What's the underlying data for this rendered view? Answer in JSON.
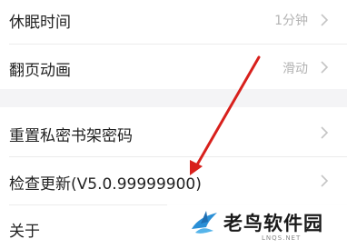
{
  "settings": {
    "group1": [
      {
        "label": "休眠时间",
        "value": "1分钟"
      },
      {
        "label": "翻页动画",
        "value": "滑动"
      }
    ],
    "group2": [
      {
        "label": "重置私密书架密码"
      },
      {
        "label": "检查更新(V5.0.99999900)"
      },
      {
        "label": "关于"
      }
    ]
  },
  "annotation": {
    "arrow_color": "#d8201c"
  },
  "watermark": {
    "text": "老鸟软件园",
    "url": "LNQS.NET"
  }
}
